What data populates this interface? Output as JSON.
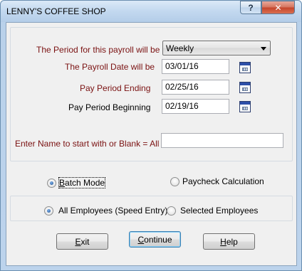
{
  "window": {
    "title": "LENNY'S COFFEE SHOP",
    "help_glyph": "?",
    "close_glyph": "✕"
  },
  "form": {
    "period_label": "The Period for this payroll will be",
    "period_value": "Weekly",
    "payroll_date_label": "The Payroll Date will be",
    "payroll_date_value": "03/01/16",
    "pay_period_ending_label": "Pay Period Ending",
    "pay_period_ending_value": "02/25/16",
    "pay_period_beginning_label": "Pay Period Beginning",
    "pay_period_beginning_value": "02/19/16",
    "name_label": "Enter Name to start with or Blank = All",
    "name_value": ""
  },
  "mode": {
    "batch": {
      "first": "B",
      "rest": "atch Mode",
      "selected": true
    },
    "paycheck": {
      "label": "Paycheck Calculation",
      "selected": false
    }
  },
  "employees": {
    "all": {
      "label": "All Employees (Speed Entry)",
      "selected": true
    },
    "selected": {
      "label": "Selected Employees",
      "selected": false
    }
  },
  "buttons": {
    "exit": {
      "first": "E",
      "rest": "xit"
    },
    "continue": {
      "first": "C",
      "rest": "ontinue"
    },
    "help": {
      "first": "H",
      "rest": "elp"
    }
  },
  "icons": [
    "help-icon",
    "close-icon",
    "calendar-icon",
    "chevron-down-icon"
  ]
}
